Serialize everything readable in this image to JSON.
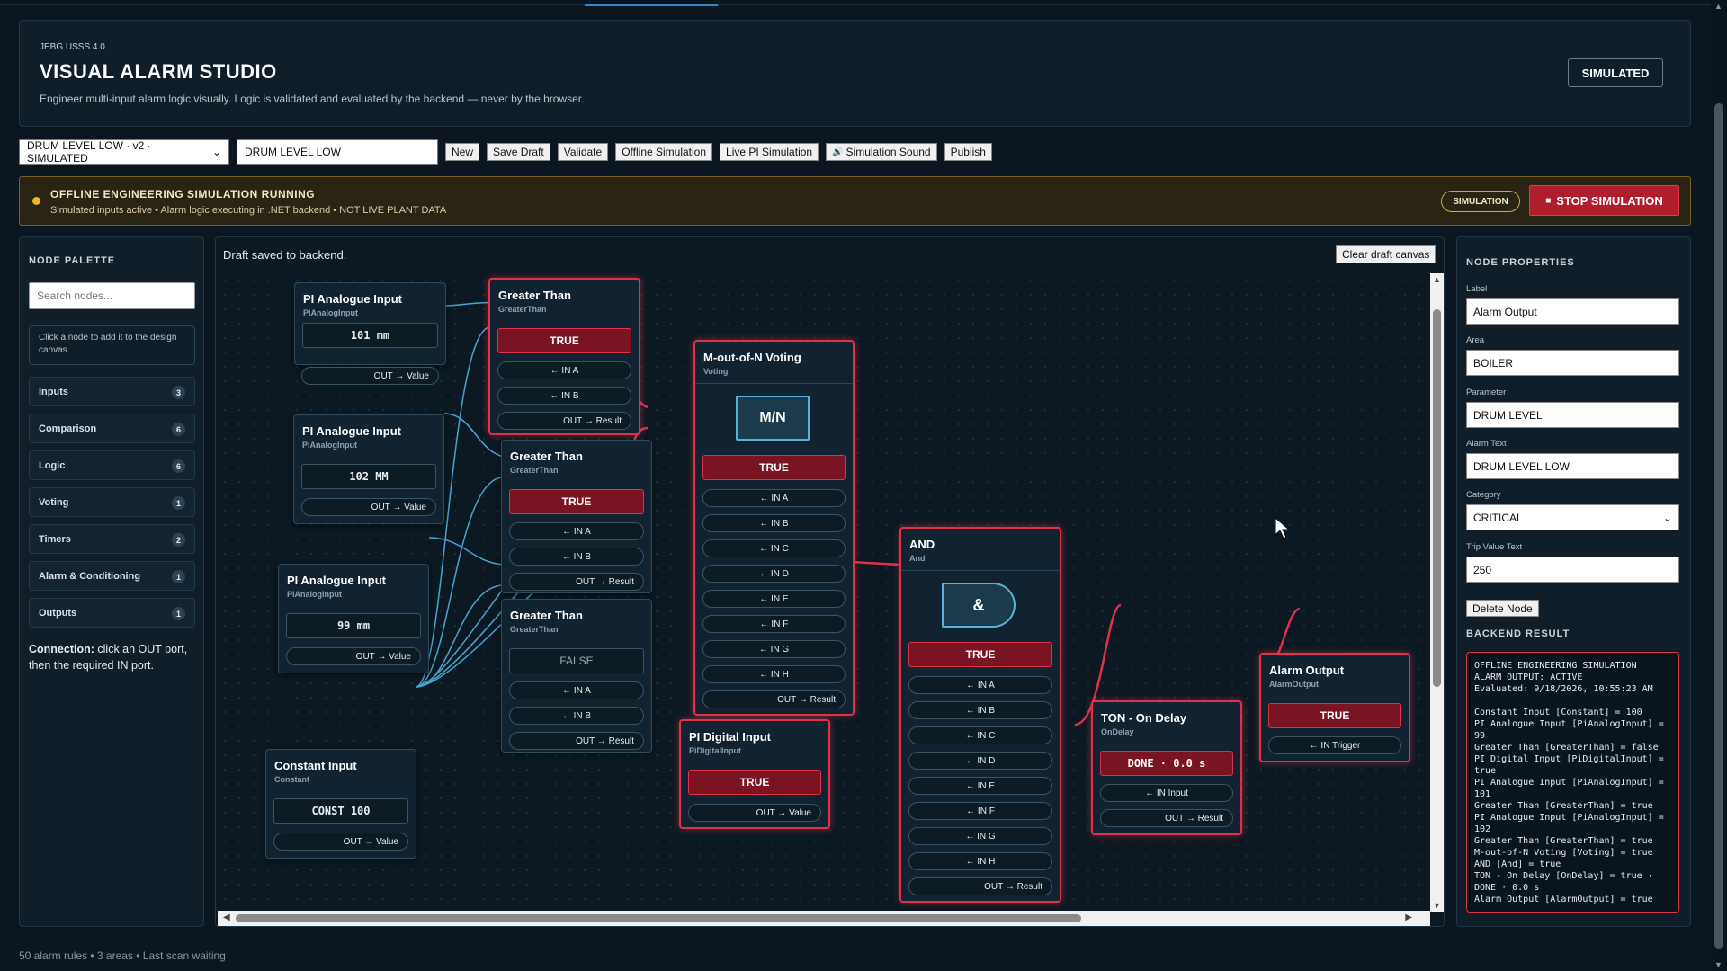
{
  "header": {
    "kicker": "JEBG USSS 4.0",
    "title": "VISUAL ALARM STUDIO",
    "subtitle": "Engineer multi-input alarm logic visually. Logic is validated and evaluated by the backend — never by the browser.",
    "mode_badge": "SIMULATED"
  },
  "toolbar": {
    "rule_select": "DRUM LEVEL LOW · v2 · SIMULATED",
    "rule_name": "DRUM LEVEL LOW",
    "buttons": [
      "New",
      "Save Draft",
      "Validate",
      "Offline Simulation",
      "Live PI Simulation",
      "Simulation Sound",
      "Publish"
    ]
  },
  "banner": {
    "title": "OFFLINE ENGINEERING SIMULATION RUNNING",
    "detail": "Simulated inputs active • Alarm logic executing in .NET backend • NOT LIVE PLANT DATA",
    "pill": "SIMULATION",
    "stop_button": "STOP SIMULATION",
    "stop_glyph": "■",
    "sound_glyph": "🔊",
    "accent_color": "#f0b429",
    "danger_color": "#b01e2e"
  },
  "palette": {
    "title": "NODE PALETTE",
    "search_placeholder": "Search nodes...",
    "hint": "Click a node to add it to the design canvas.",
    "categories": [
      {
        "label": "Inputs",
        "count": "3"
      },
      {
        "label": "Comparison",
        "count": "6"
      },
      {
        "label": "Logic",
        "count": "6"
      },
      {
        "label": "Voting",
        "count": "1"
      },
      {
        "label": "Timers",
        "count": "2"
      },
      {
        "label": "Alarm & Conditioning",
        "count": "1"
      },
      {
        "label": "Outputs",
        "count": "1"
      }
    ],
    "connection_bold": "Connection:",
    "connection_text": " click an OUT port, then the required IN port."
  },
  "canvas": {
    "status": "Draft saved to backend.",
    "clear_button": "Clear draft canvas",
    "nodes": {
      "pi1": {
        "title": "PI Analogue Input",
        "type": "PiAnalogInput",
        "value": "101 mm",
        "out": "OUT → Value"
      },
      "pi2": {
        "title": "PI Analogue Input",
        "type": "PiAnalogInput",
        "value": "102 MM",
        "out": "OUT → Value"
      },
      "pi3": {
        "title": "PI Analogue Input",
        "type": "PiAnalogInput",
        "value": "99 mm",
        "out": "OUT → Value"
      },
      "const": {
        "title": "Constant Input",
        "type": "Constant",
        "value": "CONST 100",
        "out": "OUT → Value"
      },
      "gt1": {
        "title": "Greater Than",
        "type": "GreaterThan",
        "value": "TRUE",
        "in_a": "← IN A",
        "in_b": "← IN B",
        "out": "OUT → Result"
      },
      "gt2": {
        "title": "Greater Than",
        "type": "GreaterThan",
        "value": "TRUE",
        "in_a": "← IN A",
        "in_b": "← IN B",
        "out": "OUT → Result"
      },
      "gt3": {
        "title": "Greater Than",
        "type": "GreaterThan",
        "value": "FALSE",
        "in_a": "← IN A",
        "in_b": "← IN B",
        "out": "OUT → Result"
      },
      "vote": {
        "title": "M-out-of-N Voting",
        "type": "Voting",
        "symbol": "M/N",
        "value": "TRUE",
        "inputs": [
          "← IN A",
          "← IN B",
          "← IN C",
          "← IN D",
          "← IN E",
          "← IN F",
          "← IN G",
          "← IN H"
        ],
        "out": "OUT → Result"
      },
      "dig": {
        "title": "PI Digital Input",
        "type": "PiDigitalInput",
        "value": "TRUE",
        "out": "OUT → Value"
      },
      "and": {
        "title": "AND",
        "type": "And",
        "symbol": "&",
        "value": "TRUE",
        "inputs": [
          "← IN A",
          "← IN B",
          "← IN C",
          "← IN D",
          "← IN E",
          "← IN F",
          "← IN G",
          "← IN H"
        ],
        "out": "OUT → Result"
      },
      "ton": {
        "title": "TON - On Delay",
        "type": "OnDelay",
        "value": "DONE · 0.0 s",
        "in": "← IN Input",
        "out": "OUT → Result"
      },
      "alarm": {
        "title": "Alarm Output",
        "type": "AlarmOutput",
        "value": "TRUE",
        "in": "← IN Trigger"
      }
    }
  },
  "properties": {
    "title": "NODE PROPERTIES",
    "label_lbl": "Label",
    "label_val": "Alarm Output",
    "area_lbl": "Area",
    "area_val": "BOILER",
    "param_lbl": "Parameter",
    "param_val": "DRUM LEVEL",
    "alarm_text_lbl": "Alarm Text",
    "alarm_text_val": "DRUM LEVEL LOW",
    "category_lbl": "Category",
    "category_val": "CRITICAL",
    "trip_lbl": "Trip Value Text",
    "trip_val": "250",
    "delete_button": "Delete Node",
    "backend_title": "BACKEND RESULT",
    "backend_result": "OFFLINE ENGINEERING SIMULATION\nALARM OUTPUT: ACTIVE\nEvaluated: 9/18/2026, 10:55:23 AM\n\nConstant Input [Constant] = 100\nPI Analogue Input [PiAnalogInput] =\n99\nGreater Than [GreaterThan] = false\nPI Digital Input [PiDigitalInput] =\ntrue\nPI Analogue Input [PiAnalogInput] =\n101\nGreater Than [GreaterThan] = true\nPI Analogue Input [PiAnalogInput] =\n102\nGreater Than [GreaterThan] = true\nM-out-of-N Voting [Voting] = true\nAND [And] = true\nTON - On Delay [OnDelay] = true ·\nDONE · 0.0 s\nAlarm Output [AlarmOutput] = true"
  },
  "footer": "50 alarm rules • 3 areas • Last scan waiting"
}
